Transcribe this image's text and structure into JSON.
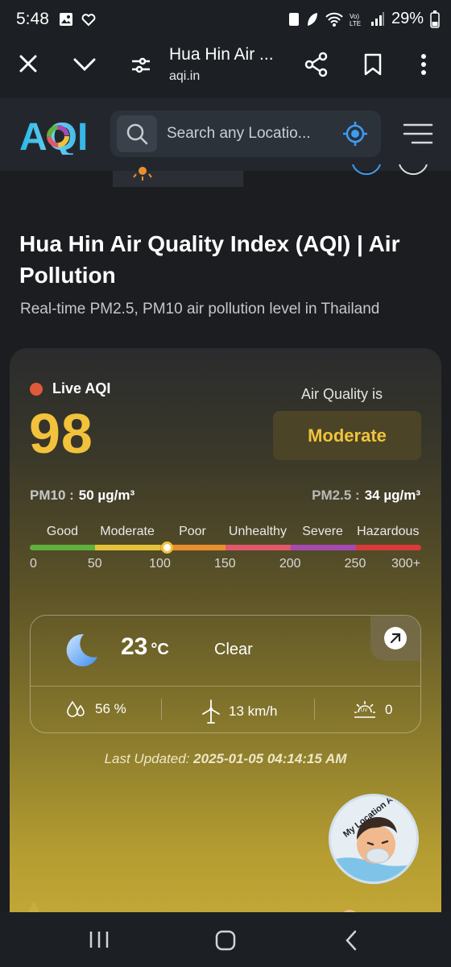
{
  "status_bar": {
    "time": "5:48",
    "battery": "29%"
  },
  "browser": {
    "page_title": "Hua Hin Air ...",
    "url": "aqi.in"
  },
  "site": {
    "logo": "AQI",
    "search_placeholder": "Search any Locatio..."
  },
  "page": {
    "title": "Hua Hin Air Quality Index (AQI) | Air Pollution",
    "subtitle": "Real-time PM2.5, PM10 air pollution level in Thailand"
  },
  "aqi_card": {
    "live_label": "Live AQI",
    "aqi_value": "98",
    "air_quality_is_label": "Air Quality is",
    "status": "Moderate",
    "status_color": "#f0c33c",
    "pm10": {
      "label": "PM10 :",
      "value": "50 µg/m³"
    },
    "pm25": {
      "label": "PM2.5 :",
      "value": "34 µg/m³"
    },
    "scale": {
      "categories": [
        "Good",
        "Moderate",
        "Poor",
        "Unhealthy",
        "Severe",
        "Hazardous"
      ],
      "ticks": [
        "0",
        "50",
        "100",
        "150",
        "200",
        "250",
        "300+"
      ],
      "colors": [
        "#5fb03c",
        "#e5c23a",
        "#e8902f",
        "#e0586a",
        "#a44ab0",
        "#d93a3a"
      ],
      "marker_value": 98,
      "max_value": 300
    },
    "weather": {
      "temperature": "23",
      "unit": "°C",
      "condition": "Clear",
      "humidity": "56 %",
      "wind": "13 km/h",
      "uv": "0"
    },
    "last_updated_label": "Last Updated:",
    "last_updated_value": "2025-01-05 04:14:15 AM"
  },
  "mascot_text": "My Location AQI"
}
